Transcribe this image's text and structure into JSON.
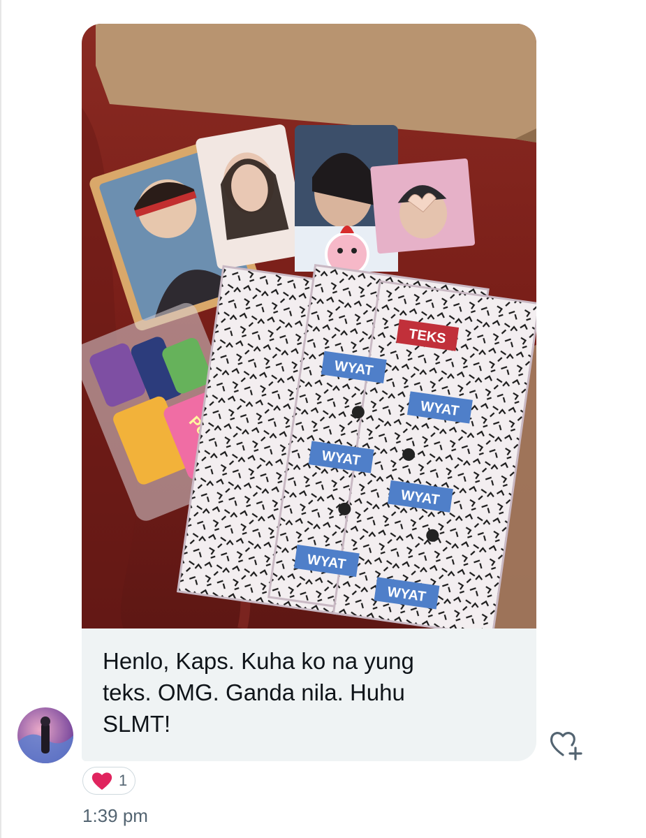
{
  "message": {
    "lines": [
      "Henlo, Kaps. Kuha ko na yung",
      "teks. OMG. Ganda nila. Huhu",
      "SLMT!"
    ],
    "photo": {
      "card_label": "TEKS",
      "sticker_label": "WYAT",
      "candy_label": "Potchi"
    }
  },
  "reactions": {
    "icon": "heart-icon",
    "count": "1"
  },
  "timestamp": "1:39 pm",
  "colors": {
    "bubble": "#eff3f4",
    "text": "#0f1419",
    "muted": "#536471",
    "heart": "#f91880"
  },
  "icons": {
    "add_reaction": "heart-plus-icon",
    "avatar": "user-avatar"
  }
}
